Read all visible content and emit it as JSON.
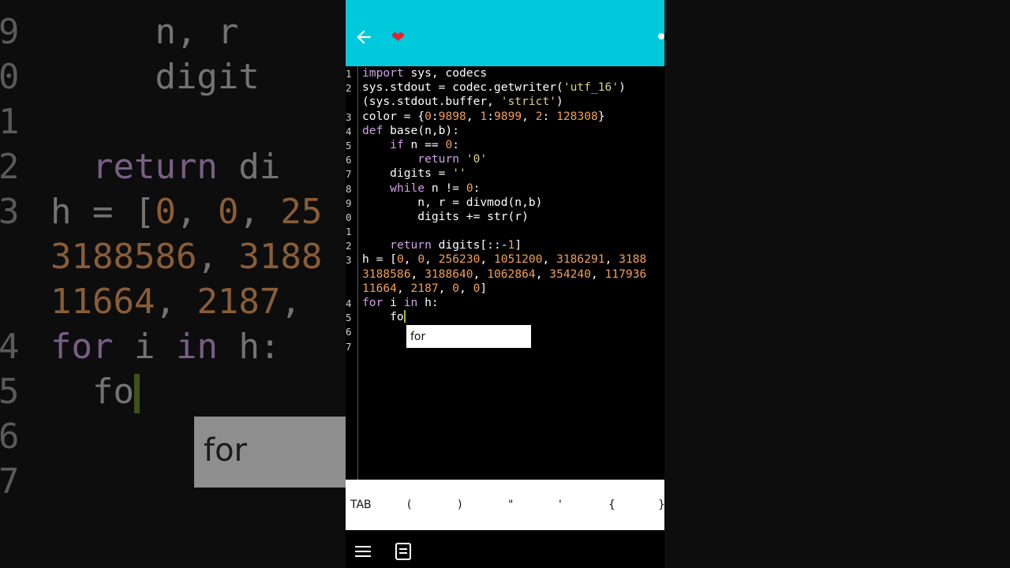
{
  "app_bar": {
    "back_icon": "arrow-left-icon",
    "favorite_icon": "heart-icon",
    "heart_glyph": "❤",
    "accent_color": "#00c9db"
  },
  "editor": {
    "lines": [
      {
        "no": "1",
        "text": "import sys, codecs"
      },
      {
        "no": "2",
        "text": "sys.stdout = codec.getwriter('utf_16')"
      },
      {
        "no": "",
        "text": "(sys.stdout.buffer, 'strict')"
      },
      {
        "no": "3",
        "text": "color = {0:9898, 1:9899, 2: 128308}"
      },
      {
        "no": "4",
        "text": "def base(n,b):"
      },
      {
        "no": "5",
        "text": "    if n == 0:"
      },
      {
        "no": "6",
        "text": "        return '0'"
      },
      {
        "no": "7",
        "text": "    digits = ''"
      },
      {
        "no": "8",
        "text": "    while n != 0:"
      },
      {
        "no": "9",
        "text": "        n, r = divmod(n,b)"
      },
      {
        "no": "0",
        "text": "        digits += str(r)"
      },
      {
        "no": "1",
        "text": ""
      },
      {
        "no": "2",
        "text": "    return digits[::-1]"
      },
      {
        "no": "3",
        "text": "h = [0, 0, 256230, 1051200, 3186291, 3188"
      },
      {
        "no": "",
        "text": "3188586, 3188640, 1062864, 354240, 117936"
      },
      {
        "no": "",
        "text": "11664, 2187, 0, 0]"
      },
      {
        "no": "4",
        "text": "for i in h:"
      },
      {
        "no": "5",
        "text": "    fo"
      },
      {
        "no": "6",
        "text": ""
      },
      {
        "no": "7",
        "text": ""
      }
    ],
    "autocomplete": {
      "suggestion": "for"
    }
  },
  "keybar": {
    "keys": [
      "TAB",
      "(",
      ")",
      "\"",
      "'",
      "{",
      "}"
    ]
  },
  "navbar": {
    "menu_icon": "hamburger-menu-icon",
    "doc_icon": "document-icon"
  },
  "background": {
    "left_lines": [
      {
        "no": "9",
        "text": "     n, r"
      },
      {
        "no": "0",
        "text": "     digit"
      },
      {
        "no": "1",
        "text": ""
      },
      {
        "no": "2",
        "text": "  return di"
      },
      {
        "no": "3",
        "text": "h = [0, 0, 25"
      },
      {
        "no": "",
        "text": "3188586, 3188"
      },
      {
        "no": "",
        "text": "11664, 2187,"
      },
      {
        "no": "4",
        "text": "for i in h:"
      },
      {
        "no": "5",
        "text": "  fo"
      },
      {
        "no": "6",
        "text": ""
      },
      {
        "no": "7",
        "text": ""
      }
    ],
    "right_lines": [
      {
        "text": ""
      },
      {
        "text": ""
      },
      {
        "text": ""
      },
      {
        "text": ""
      },
      {
        "text": "3186291, 3188"
      },
      {
        "text": "354240, 117936"
      }
    ],
    "popup_text": "for"
  }
}
